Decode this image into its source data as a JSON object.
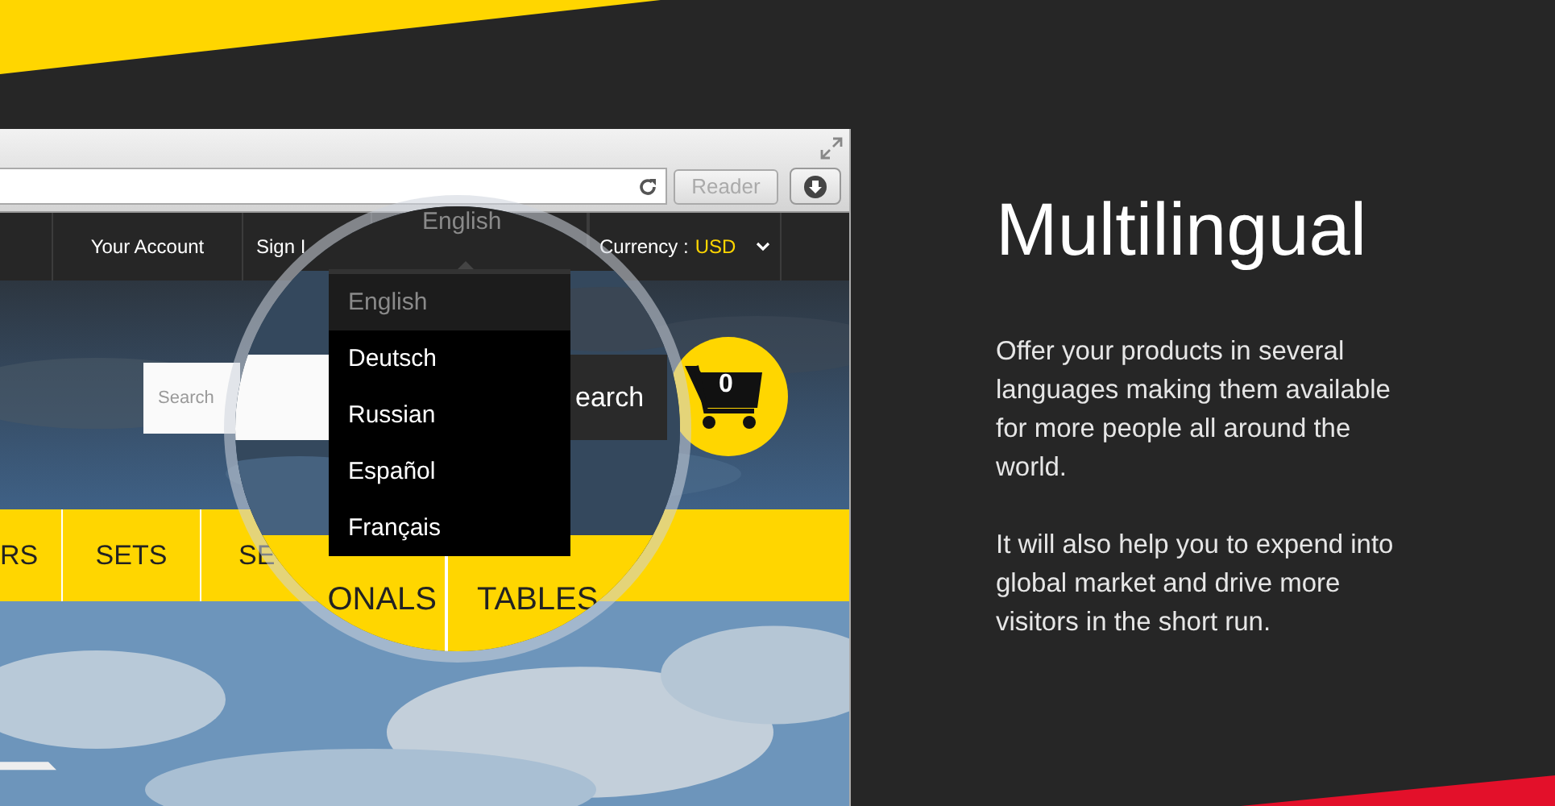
{
  "browser": {
    "reader_button": "Reader",
    "top_nav": [
      {
        "label": "Your Account"
      },
      {
        "label": "Sign I"
      }
    ],
    "currency": {
      "label": "Currency :",
      "value": "USD"
    },
    "search": {
      "placeholder": "Search"
    },
    "cart": {
      "count": "0"
    },
    "menu": [
      "RS",
      "SETS",
      "SE"
    ]
  },
  "magnifier": {
    "header_label": "English",
    "languages": [
      {
        "label": "English",
        "selected": true
      },
      {
        "label": "Deutsch",
        "selected": false
      },
      {
        "label": "Russian",
        "selected": false
      },
      {
        "label": "Español",
        "selected": false
      },
      {
        "label": "Français",
        "selected": false
      }
    ],
    "search_button": "earch",
    "menu": [
      "ONALS",
      "TABLES"
    ]
  },
  "feature": {
    "title": "Multilingual",
    "paragraphs": [
      "Offer your products in several languages making them available for more people all around the world.",
      "It will also help you to expend into global market and drive more visitors in the short run."
    ]
  }
}
